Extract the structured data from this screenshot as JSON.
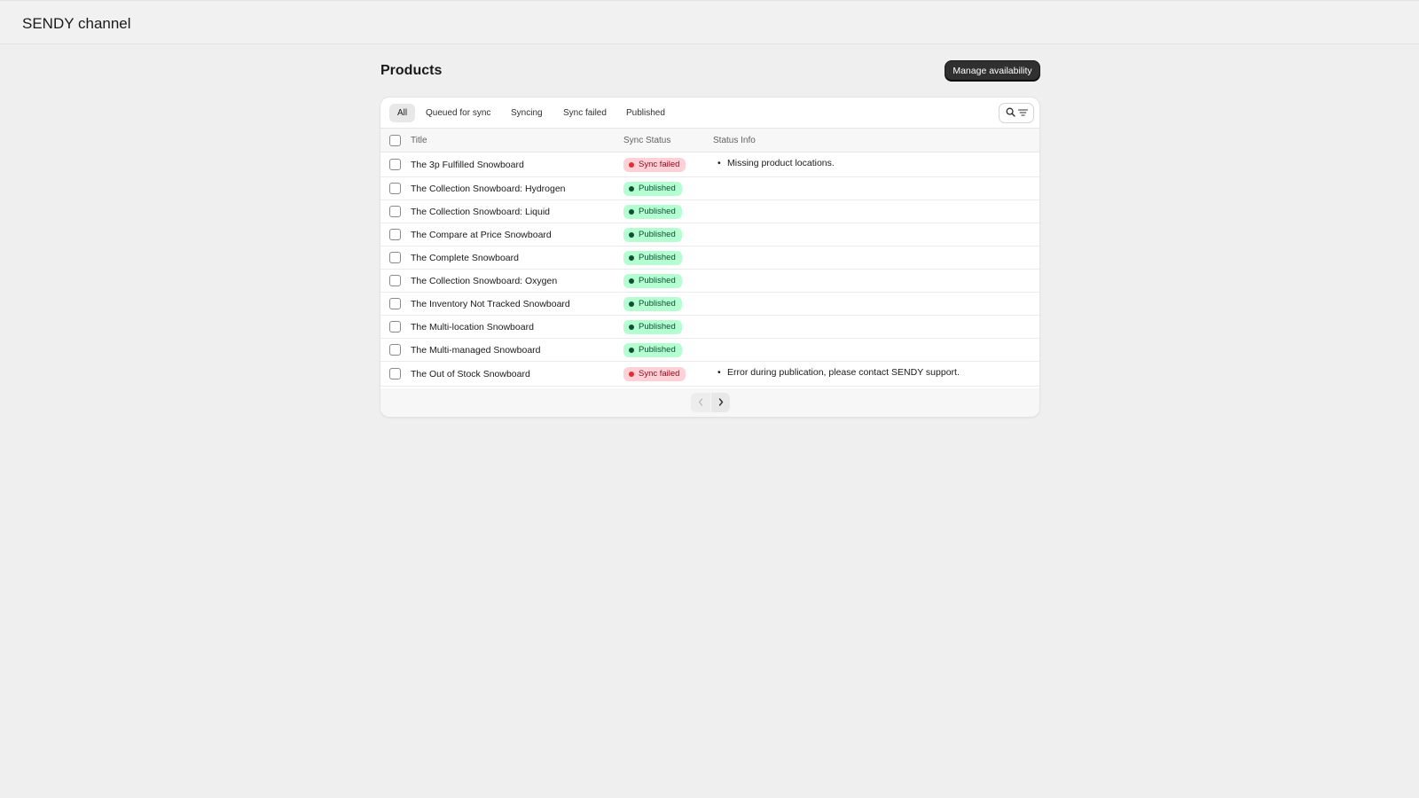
{
  "app": {
    "title": "SENDY channel"
  },
  "page": {
    "title": "Products",
    "primary_action": "Manage availability"
  },
  "tabs": [
    {
      "label": "All",
      "selected": true
    },
    {
      "label": "Queued for sync",
      "selected": false
    },
    {
      "label": "Syncing",
      "selected": false
    },
    {
      "label": "Sync failed",
      "selected": false
    },
    {
      "label": "Published",
      "selected": false
    }
  ],
  "table": {
    "columns": [
      "Title",
      "Sync Status",
      "Status Info"
    ],
    "rows": [
      {
        "title": "The 3p Fulfilled Snowboard",
        "status": "Sync failed",
        "info": "Missing product locations."
      },
      {
        "title": "The Collection Snowboard: Hydrogen",
        "status": "Published",
        "info": ""
      },
      {
        "title": "The Collection Snowboard: Liquid",
        "status": "Published",
        "info": ""
      },
      {
        "title": "The Compare at Price Snowboard",
        "status": "Published",
        "info": ""
      },
      {
        "title": "The Complete Snowboard",
        "status": "Published",
        "info": ""
      },
      {
        "title": "The Collection Snowboard: Oxygen",
        "status": "Published",
        "info": ""
      },
      {
        "title": "The Inventory Not Tracked Snowboard",
        "status": "Published",
        "info": ""
      },
      {
        "title": "The Multi-location Snowboard",
        "status": "Published",
        "info": ""
      },
      {
        "title": "The Multi-managed Snowboard",
        "status": "Published",
        "info": ""
      },
      {
        "title": "The Out of Stock Snowboard",
        "status": "Sync failed",
        "info": "Error during publication, please contact SENDY support."
      }
    ]
  },
  "pagination": {
    "previous_enabled": false,
    "next_enabled": true
  },
  "icons": {
    "search": "search-icon",
    "filter": "filter-icon",
    "previous": "chevron-left-icon",
    "next": "chevron-right-icon"
  },
  "colors": {
    "background": "#efefef",
    "primary_button": "#303030",
    "published_badge_bg": "#b4fed2",
    "published_badge_text": "#0c5132",
    "failed_badge_bg": "#fed1d7",
    "failed_badge_dot": "#e22c38"
  }
}
